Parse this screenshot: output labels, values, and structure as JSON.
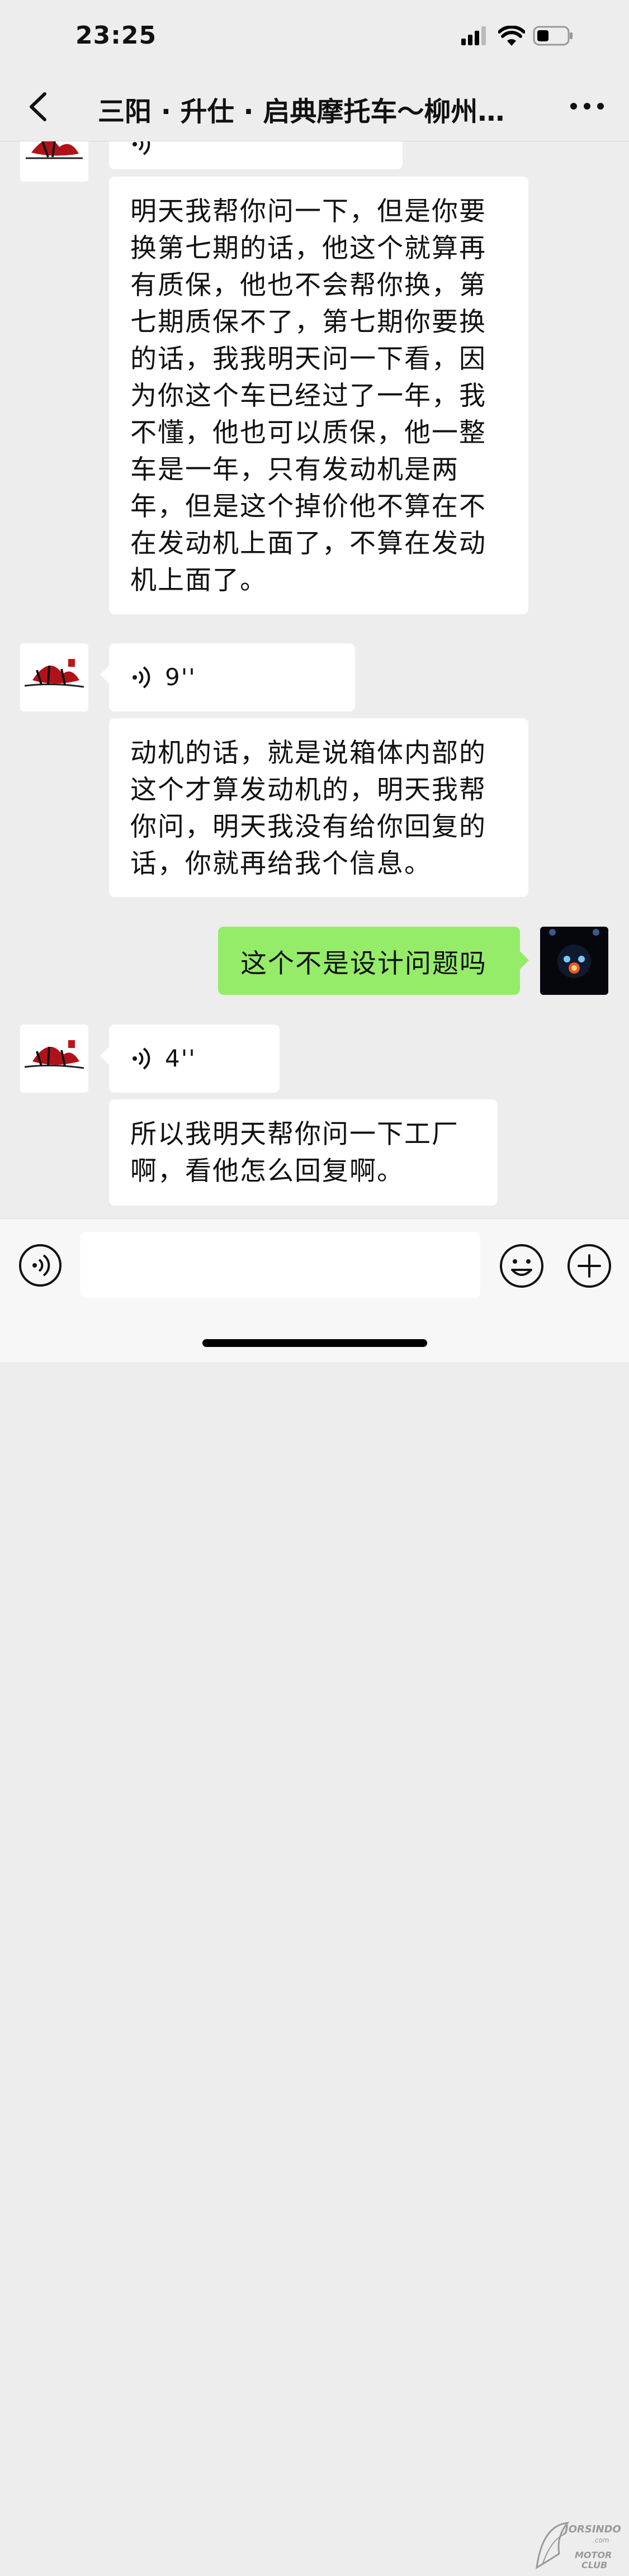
{
  "status_bar": {
    "time": "23:25"
  },
  "header": {
    "title": "三阳 · 升仕 · 启典摩托车～柳州…"
  },
  "messages": [
    {
      "text": "明天我帮你问一下，但是你要换第七期的话，他这个就算再有质保，他也不会帮你换，第七期质保不了，第七期你要换的话，我我明天问一下看，因为你这个车已经过了一年，我不懂，他也可以质保，他一整车是一年，只有发动机是两年，但是这个掉价他不算在不在发动机上面了，不算在发动机上面了。"
    },
    {
      "duration": "9''"
    },
    {
      "text": "动机的话，就是说箱体内部的这个才算发动机的，明天我帮你问，明天我没有给你回复的话，你就再给我个信息。"
    },
    {
      "text": "这个不是设计问题吗"
    },
    {
      "duration": "4''"
    },
    {
      "text": "所以我明天帮你问一下工厂啊，看他怎么回复啊。"
    }
  ],
  "input_bar": {
    "placeholder": ""
  },
  "watermark": {
    "text": "JORSINDO.com MOTOR CLUB"
  }
}
